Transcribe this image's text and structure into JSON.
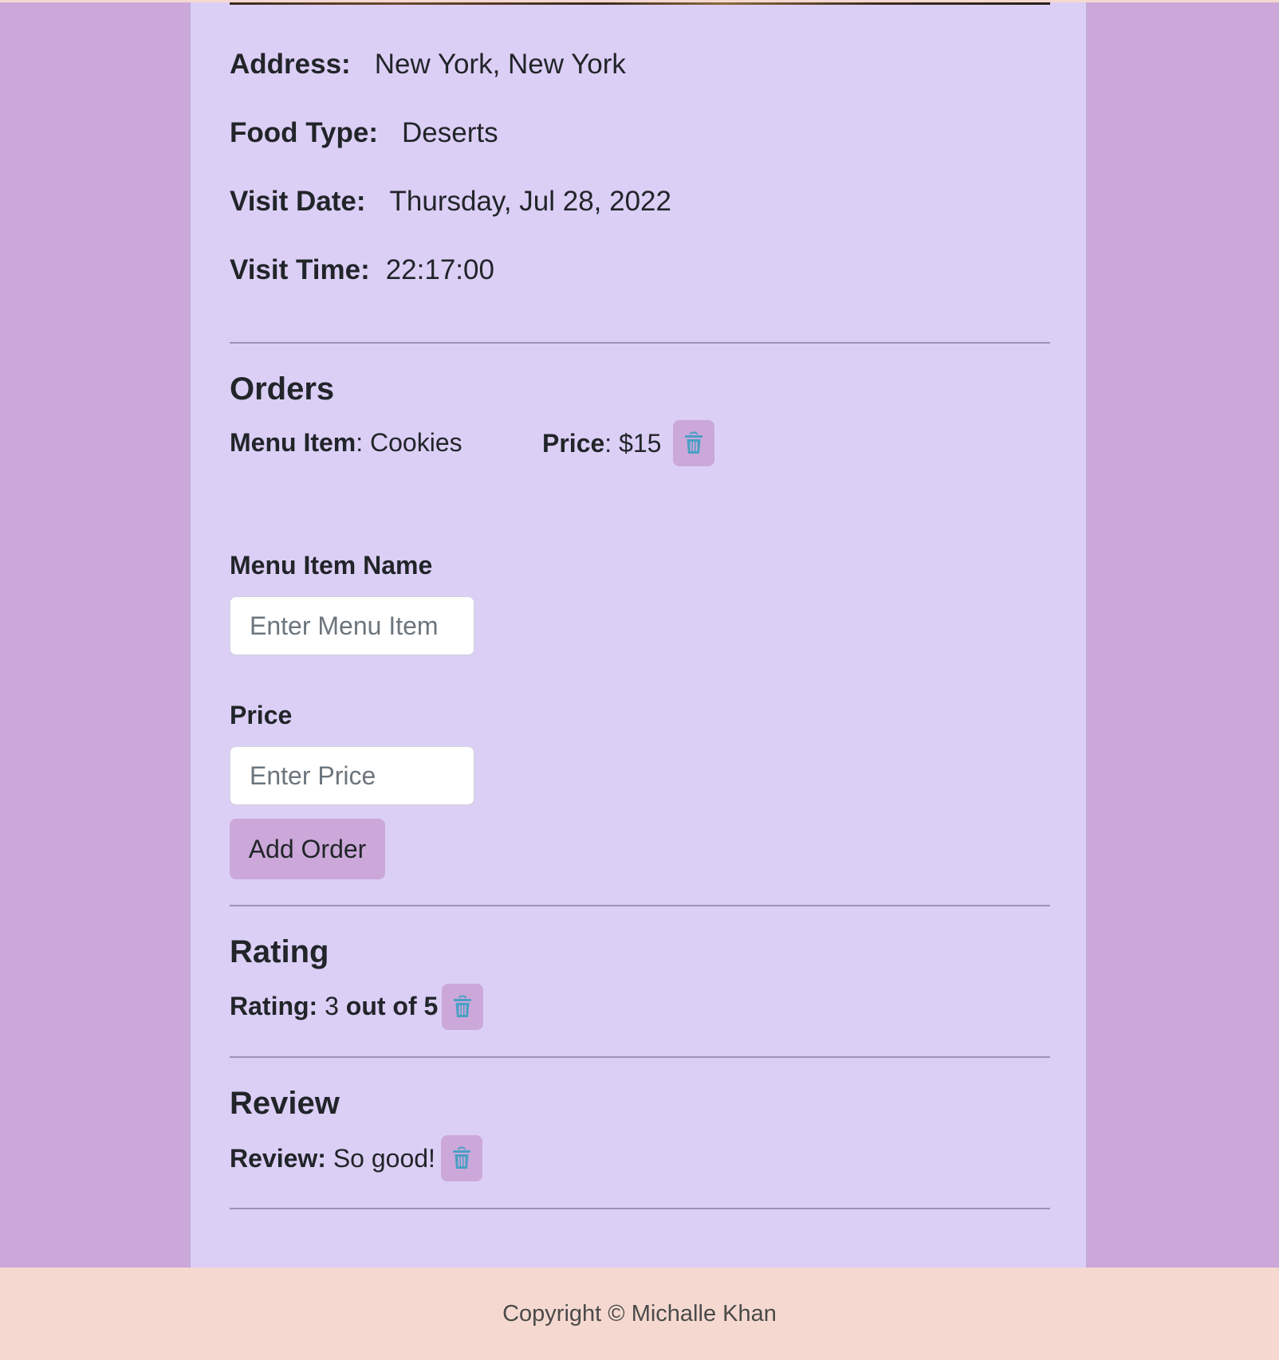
{
  "details": {
    "address_label": "Address:",
    "address_value": "New York, New York",
    "food_type_label": "Food Type:",
    "food_type_value": "Deserts",
    "visit_date_label": "Visit Date:",
    "visit_date_value": "Thursday, Jul 28, 2022",
    "visit_time_label": "Visit Time:",
    "visit_time_value": "22:17:00"
  },
  "orders": {
    "title": "Orders",
    "items": [
      {
        "menu_item_label": "Menu Item",
        "menu_item_value": ": Cookies",
        "price_label": "Price",
        "price_value": ": $15"
      }
    ],
    "form": {
      "menu_item_label": "Menu Item Name",
      "menu_item_placeholder": "Enter Menu Item",
      "price_label": "Price",
      "price_placeholder": "Enter Price",
      "submit_label": "Add Order"
    }
  },
  "rating": {
    "title": "Rating",
    "label": "Rating:",
    "value": " 3",
    "suffix": " out of 5",
    "score": 3,
    "max": 5
  },
  "review": {
    "title": "Review",
    "label": "Review:",
    "value": " So good!"
  },
  "footer": {
    "copyright": "Copyright © Michalle Khan"
  },
  "icons": {
    "delete": "trash-icon"
  },
  "colors": {
    "page_background": "#cba8d9",
    "card_background": "#dccff6",
    "button_background": "#cba8d9",
    "trash_icon": "#4a9fc4",
    "footer_background": "#f5d9d0"
  }
}
